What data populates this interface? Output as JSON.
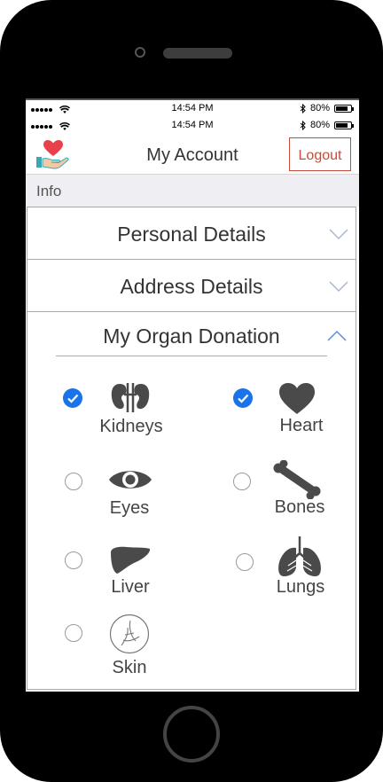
{
  "status_outer": {
    "time": "14:54 PM",
    "battery": "80%",
    "battery_level": 0.8
  },
  "status_inner": {
    "time": "14:54 PM",
    "battery": "80%",
    "battery_level": 0.8
  },
  "header": {
    "title": "My Account",
    "logout_label": "Logout"
  },
  "info_label": "Info",
  "sections": {
    "personal": "Personal Details",
    "address": "Address Details",
    "donation": "My Organ Donation"
  },
  "organs": [
    {
      "label": "Kidneys",
      "icon": "kidneys-icon",
      "selected": true
    },
    {
      "label": "Heart",
      "icon": "heart-icon",
      "selected": true
    },
    {
      "label": "Eyes",
      "icon": "eye-icon",
      "selected": false
    },
    {
      "label": "Bones",
      "icon": "bone-icon",
      "selected": false
    },
    {
      "label": "Liver",
      "icon": "liver-icon",
      "selected": false
    },
    {
      "label": "Lungs",
      "icon": "lungs-icon",
      "selected": false
    },
    {
      "label": "Skin",
      "icon": "skin-icon",
      "selected": false
    }
  ],
  "colors": {
    "accent": "#1a73e8",
    "logout": "#c94a3b",
    "icon": "#4a4a4a",
    "logo_heart": "#e8414b",
    "logo_hand": "#3aa6b9"
  }
}
